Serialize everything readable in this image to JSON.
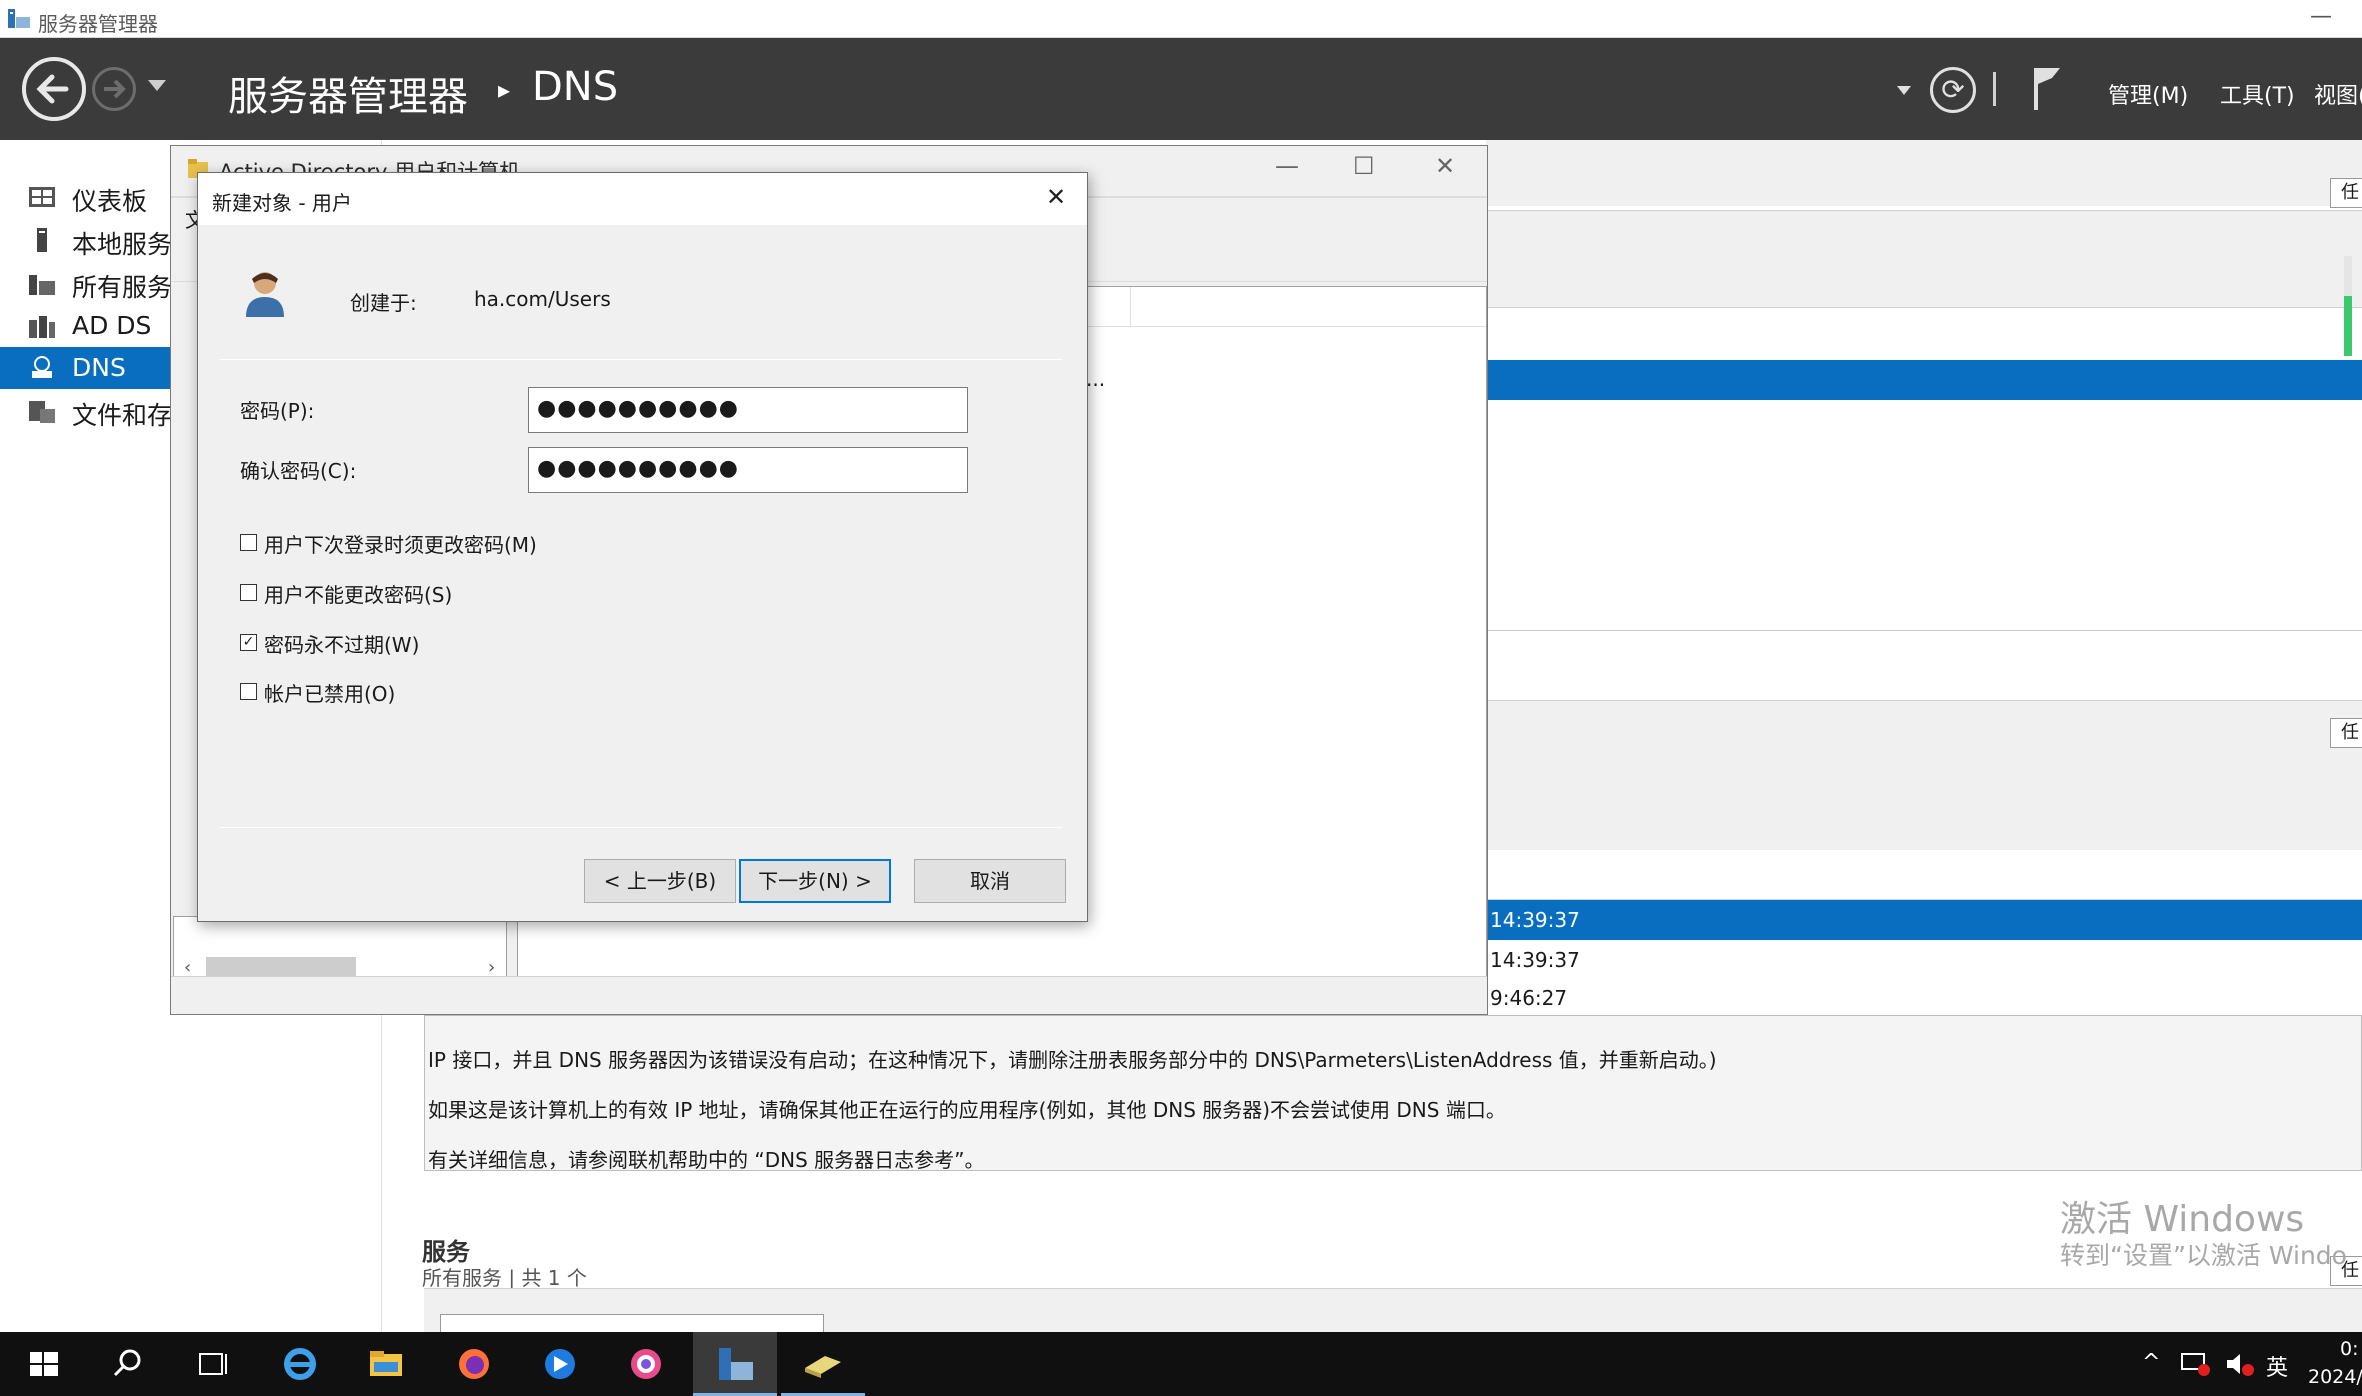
{
  "window": {
    "title": "服务器管理器",
    "min_icon": "minimize-icon"
  },
  "header": {
    "breadcrumb_root": "服务器管理器",
    "breadcrumb_sep": "▸",
    "breadcrumb_leaf": "DNS",
    "menus": {
      "manage": "管理(M)",
      "tools": "工具(T)",
      "view": "视图("
    }
  },
  "sidebar": {
    "items": [
      {
        "label": "仪表板",
        "icon": "dashboard-icon"
      },
      {
        "label": "本地服务",
        "icon": "server-icon"
      },
      {
        "label": "所有服务",
        "icon": "servers-icon"
      },
      {
        "label": "AD DS",
        "icon": "ad-ds-icon"
      },
      {
        "label": "DNS",
        "icon": "dns-icon",
        "selected": true
      },
      {
        "label": "文件和存",
        "icon": "file-storage-icon"
      }
    ]
  },
  "aduc": {
    "title": "Active Directory 用户和计算机",
    "menu_char": "文",
    "ellipsis": "..."
  },
  "dialog": {
    "title": "新建对象 - 用户",
    "created_in_label": "创建于:",
    "created_in_value": "ha.com/Users",
    "password_label": "密码(P):",
    "password_value": "●●●●●●●●●●",
    "confirm_label": "确认密码(C):",
    "confirm_value": "●●●●●●●●●●",
    "options": [
      {
        "label": "用户下次登录时须更改密码(M)",
        "checked": false
      },
      {
        "label": "用户不能更改密码(S)",
        "checked": false
      },
      {
        "label": "密码永不过期(W)",
        "checked": true
      },
      {
        "label": "帐户已禁用(O)",
        "checked": false
      }
    ],
    "back_button": "< 上一步(B)",
    "next_button": "下一步(N) >",
    "cancel_button": "取消"
  },
  "tasks_label": "任",
  "events": [
    {
      "time": "14:39:37",
      "selected": true
    },
    {
      "time": "14:39:37",
      "selected": false
    },
    {
      "time": "9:46:27",
      "selected": false
    }
  ],
  "event_detail": [
    "IP 接口，并且 DNS 服务器因为该错误没有启动；在这种情况下，请删除注册表服务部分中的 DNS\\Parmeters\\ListenAddress 值，并重新启动。)",
    "如果这是该计算机上的有效 IP 地址，请确保其他正在运行的应用程序(例如，其他 DNS 服务器)不会尝试使用 DNS 端口。",
    "有关详细信息，请参阅联机帮助中的 “DNS 服务器日志参考”。"
  ],
  "services": {
    "heading": "服务",
    "sub": "所有服务 | 共 1 个"
  },
  "watermark": {
    "line1": "激活 Windows",
    "line2": "转到“设置”以激活 Windo"
  },
  "taskbar": {
    "clock_time": "0:",
    "clock_date": "2024/",
    "ime": "英",
    "colors": {
      "bg": "#101010",
      "accent": "#0a6ec0"
    }
  }
}
